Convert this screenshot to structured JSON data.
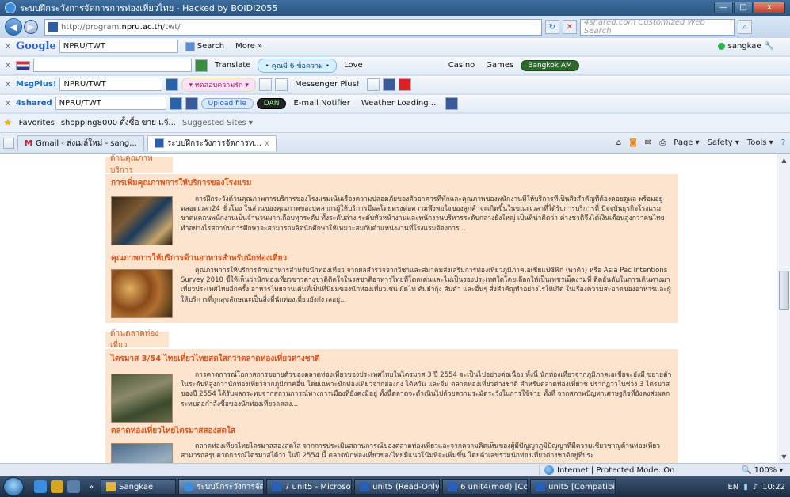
{
  "window": {
    "title": "ระบบฝึกระวังการจัดการการท่องเที่ยวไทย - Hacked by BOIDI2055",
    "min_label": "—",
    "max_label": "□",
    "close_label": "x"
  },
  "address": {
    "prefix": "http://program.",
    "domain": "npru.ac.th",
    "path": "/twt/",
    "search_placeholder": "4shared.com Customized Web Search"
  },
  "toolbar_google": {
    "close": "x",
    "logo": "Google",
    "query": "NPRU/TWT",
    "search_label": "Search",
    "more_label": "More »",
    "user_label": "sangkae"
  },
  "toolbar_translate": {
    "close": "x",
    "translate_label": "Translate",
    "news_label": "• คุณมี 6 ข้อความ •",
    "love_label": "Love",
    "casino_label": "Casino",
    "games_label": "Games",
    "weather_label": "Bangkok AM"
  },
  "toolbar_msg": {
    "close": "x",
    "brand": "MsgPlus!",
    "query": "NPRU/TWT",
    "survey_label": "▾ ทดสอบความรัก ▾",
    "messenger_label": "Messenger Plus!"
  },
  "toolbar_4shared": {
    "close": "x",
    "brand": "4shared",
    "query": "NPRU/TWT",
    "upload_label": "Upload file",
    "dan_label": "DAN",
    "email_label": "E-mail Notifier",
    "weather_label": "Weather Loading ..."
  },
  "favorites": {
    "label": "Favorites",
    "item1": "shopping8000 ตั้งซื้อ ขาย แจ้...",
    "item2": "Suggested Sites ▾"
  },
  "tabs": [
    {
      "label": "Gmail - ส่งเมล์ใหม่ - sang..."
    },
    {
      "label": "ระบบฝึกระวังการจัดการท...",
      "close": "x"
    }
  ],
  "commands": {
    "page": "Page ▾",
    "safety": "Safety ▾",
    "tools": "Tools ▾"
  },
  "content": {
    "section1_label": "ด้านคุณภาพบริการ",
    "article1_title": "การเพิ่มคุณภาพการให้บริการของโรงแรม",
    "article1_body": "การฝึกระวังด้านคุณภาพการบริการของโรงแรมเน้นเรื่องความปลอดภัยของตัวอาคารที่พักและคุณภาพของพนักงานที่ให้บริการที่เป็นสิ่งสำคัญที่ต้องคอยดูแล พร้อมอยู่ตลอดเวลา24 ชั่วโมง ในส่วนของคุณภาพของบุคลากรผู้ให้บริการมีผลโดยตรงต่อความพึงพอใจของลูกค้าจะเกิดขึ้นในขณะเวลาที่ได้รับการบริการที่ ปัจจุบันธุรกิจโรงแรมขาดแคลนพนักงานเป็นจำนวนมากเกือบทุกระดับ ทั้งระดับล่าง ระดับหัวหน้างานและพนักงานบริหารระดับกลางยังใหญ่ เป็นที่น่าคิดว่า ต่างชาติจึงได้เงินเดือนสูงกว่าคนไทย ทำอย่างไรสถาบันการศึกษาจะสามารถผลิตนักศึกษาให้เหมาะสมกับตำแหน่งงานที่โรงแรมต้องการ...",
    "article2_title": "คุณภาพการให้บริการด้านอาหารสำหรับนักท่องเที่ยว",
    "article2_body": "คุณภาพการให้บริการด้านอาหารสำหรับนักท่องเที่ยว จากผลสำรวจจากวิชาและสมาคมส่งเสริมการท่องเที่ยวภูมิภาคเอเชียแปซิฟิก (พาต้า) หรือ Asia Pac Intentions Survey 2010 ชี้ให้เห็นว่านักท่องเที่ยวชาวต่างชาติติดใจในรสชาติอาหารไทยที่โดดเด่นและไม่เป็นรองประเทศใดโดยเลือกให้เป็นเพชรเม็ดงามที่ ติดอันดับในการเดินทางมาเที่ยวประเทศไทยอีกครั้ง อาหารไทยจานเด่นที่เป็นที่นิยมของนักท่องเที่ยวเช่น ผัดไท ต้มยำกุ้ง ส้มตำ และอื่นๆ สิ่งสำคัญทำอย่างไรให้เกิด ในเรื่องความสะอาดของอาหารและผู้ให้บริการที่ถูกสุขลักษณะเป็นสิ่งที่นักท่องเที่ยวยังกังวลอยู่...",
    "section2_label": "ด้านตลาดท่องเที่ยว",
    "article3_title": "ไตรมาส 3/54 ไทยเที่ยวไทยสดใสกว่าตลาดท่องเที่ยวต่างชาติ",
    "article3_body": "การคาดการณ์โอกาสการขยายตัวของตลาดท่องเที่ยวของประเทศไทยในไตรมาส 3 ปี 2554 จะเป็นไปอย่างต่อเนื่อง ทั้งนี้ นักท่องเที่ยวจากภูมิภาคเอเชียจะยังมี ขยายตัวในระดับที่สูงกว่านักท่องเที่ยวจากภูมิภาคอื่น โดยเฉพาะนักท่องเที่ยวจากฮ่องกง ไต้หวัน และจีน ตลาดท่องเที่ยวต่างชาติ สำหรับตลาดท่องเที่ยวช ปรากฏว่าในช่วง 3 ไตรมาสของปี 2554 ได้รับผลกระทบจากสถานการณ์ทางการเมืองที่ยังคงมีอยู่ ทั้งนี้ตลาดจะดำเนินไปด้วยความระมัดระวังในการใช้จ่าย ทั้งที่ จากสภาพปัญหาเศรษฐกิจที่ยังคงส่งผลกระทบต่อกำลังซื้อของนักท่องเที่ยวลดลง...",
    "article4_title": "ตลาดท่องเที่ยวไทยไตรมาสสองสดใส",
    "article4_body": "ตลาดท่องเที่ยวไทยไตรมาสสองสดใส จากการประเมินสถานการณ์ของตลาดท่องเที่ยวและจากความคิดเห็นของผู้มีปัญญาภูมิปัญญาที่มีความเชี่ยวชาญด้านท่องเที่ยว สามารถสรุปคาดการณ์ไตรมาสได้ว่า ในปี 2554 นี้ ตลาดนักท่องเที่ยวของไทยมีแนวโน้มที่จะเพิ่มขึ้น โดยตัวเลขรวมนักท่องเที่ยวต่างชาติอยู่ที่ประ"
  },
  "status": {
    "zone": "Internet | Protected Mode: On",
    "zoom": "100%"
  },
  "taskbar": {
    "sep": "»",
    "items": [
      {
        "label": "Sangkae"
      },
      {
        "label": "ระบบฝึกระวังการจัด..."
      },
      {
        "label": "7 unit5 - Microsof..."
      },
      {
        "label": "unit5 (Read-Only)..."
      },
      {
        "label": "6 unit4(mod) [Co..."
      },
      {
        "label": "unit5 [Compatibil..."
      }
    ],
    "lang": "EN",
    "clock": "10:22"
  }
}
